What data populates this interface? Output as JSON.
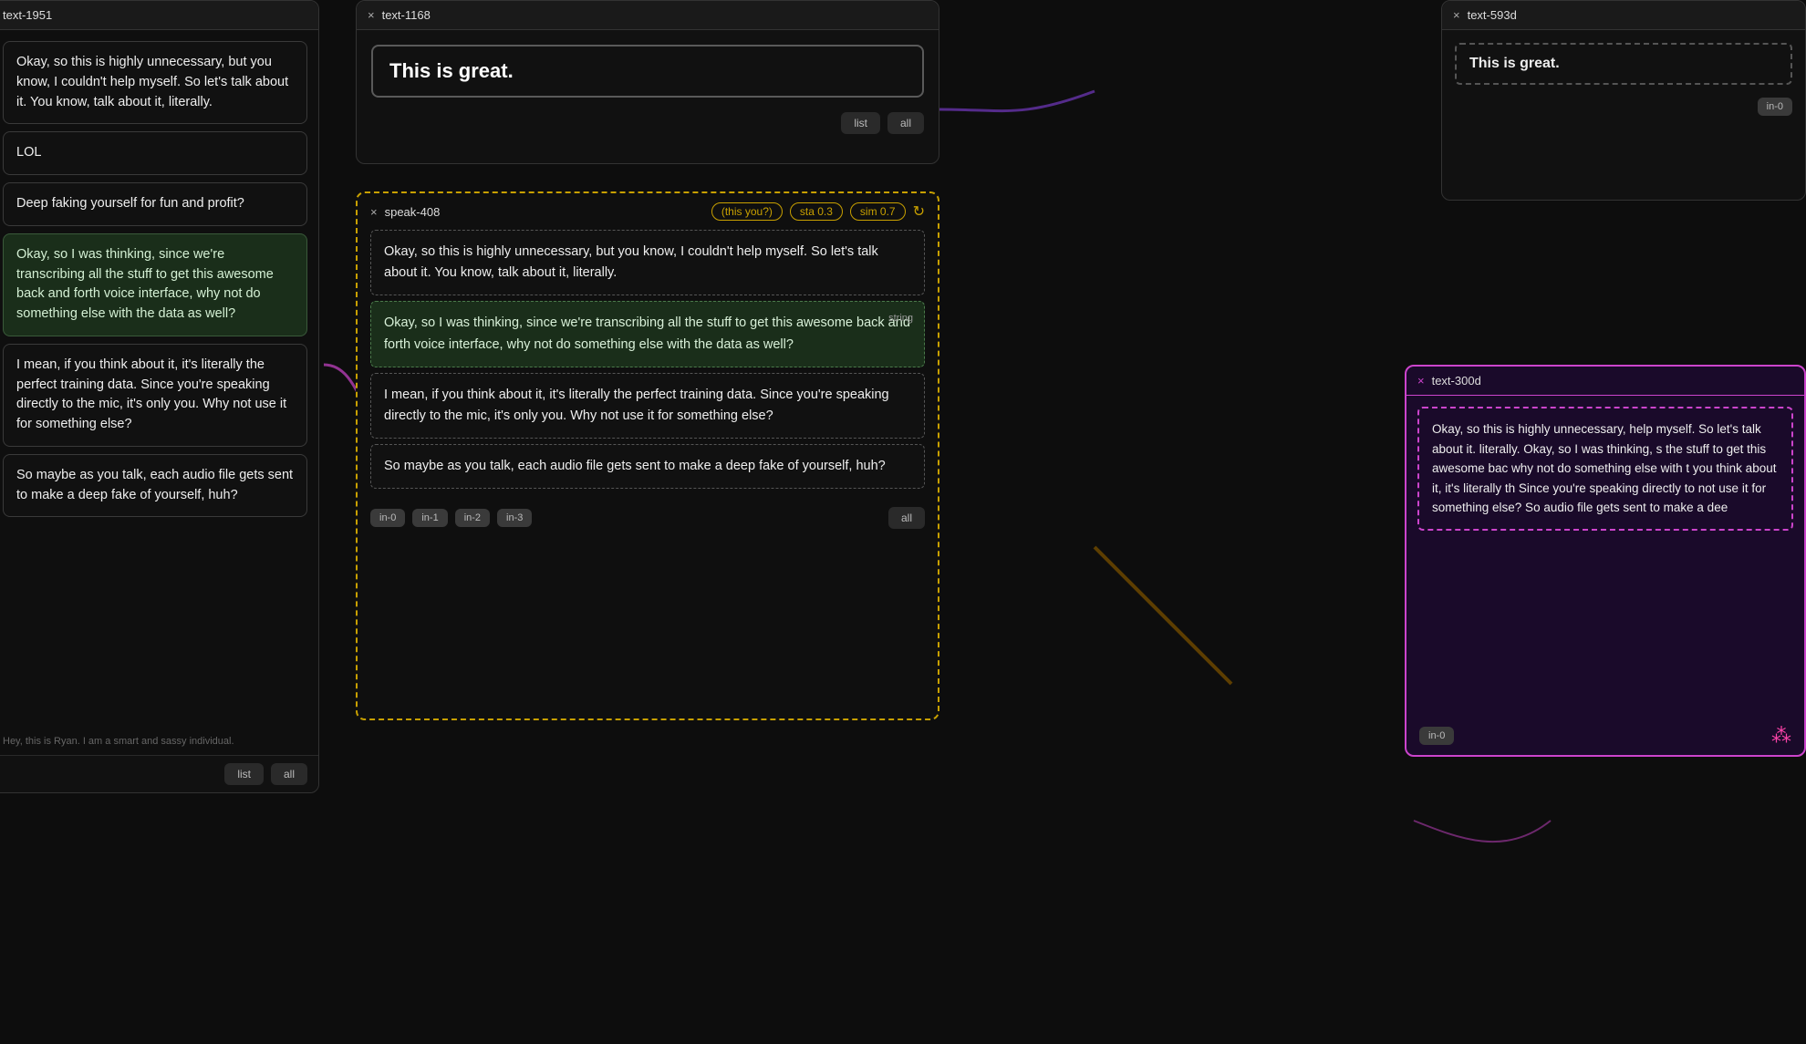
{
  "left_card": {
    "id": "text-1951",
    "messages": [
      {
        "text": "Okay, so this is highly unnecessary, but you know, I couldn't help myself. So let's talk about it. You know, talk about it, literally.",
        "type": "normal"
      },
      {
        "text": "LOL",
        "type": "normal"
      },
      {
        "text": "Deep faking yourself for fun and profit?",
        "type": "normal"
      },
      {
        "text": "Okay, so I was thinking, since we're transcribing all the stuff to get this awesome back and forth voice interface, why not do something else with the data as well?",
        "type": "green"
      },
      {
        "text": "I mean, if you think about it, it's literally the perfect training data. Since you're speaking directly to the mic, it's only you. Why not use it for something else?",
        "type": "normal"
      },
      {
        "text": "So maybe as you talk, each audio file gets sent to make a deep fake of yourself, huh?",
        "type": "normal"
      }
    ],
    "footer_text": "Hey, this is Ryan. I am a smart and sassy individual.",
    "btn_list": "list",
    "btn_all": "all"
  },
  "mid_top_card": {
    "id": "text-1168",
    "close": "×",
    "input_text": "This is great.",
    "btn_list": "list",
    "btn_all": "all"
  },
  "speak_card": {
    "id": "speak-408",
    "close": "×",
    "tag_this_you": "(this you?)",
    "tag_sta": "sta 0.3",
    "tag_sim": "sim 0.7",
    "messages": [
      {
        "text": "Okay, so this is highly unnecessary, but you know, I couldn't help myself. So let's talk about it. You know, talk about it, literally.",
        "type": "normal"
      },
      {
        "text": "Okay, so I was thinking, since we're transcribing all the stuff to get this awesome back and forth voice interface, why not do something else with the data as well?",
        "type": "green",
        "badge": "string"
      },
      {
        "text": "I mean, if you think about it, it's literally the perfect training data. Since you're speaking directly to the mic, it's only you. Why not use it for something else?",
        "type": "normal"
      },
      {
        "text": "So maybe as you talk, each audio file gets sent to make a deep fake of yourself, huh?",
        "type": "normal"
      }
    ],
    "btns_in": [
      "in-0",
      "in-1",
      "in-2",
      "in-3"
    ],
    "btn_all": "all"
  },
  "right_top_card": {
    "id": "text-593d",
    "close": "×",
    "text": "This is great.",
    "btn_in0": "in-0"
  },
  "right_bottom_card": {
    "id": "text-300d",
    "close": "×",
    "text": "Okay, so this is highly unnecessary, help myself. So let's talk about it. literally. Okay, so I was thinking, s the stuff to get this awesome bac why not do something else with t you think about it, it's literally th Since you're speaking directly to not use it for something else? So audio file gets sent to make a dee",
    "btn_in0": "in-0",
    "icon": "⁂"
  },
  "colors": {
    "gold": "#c8a000",
    "purple": "#cc44cc",
    "green_bg": "#1a2e1a",
    "green_border": "#4a7a4a",
    "dark_bg": "#0d0d0d"
  }
}
